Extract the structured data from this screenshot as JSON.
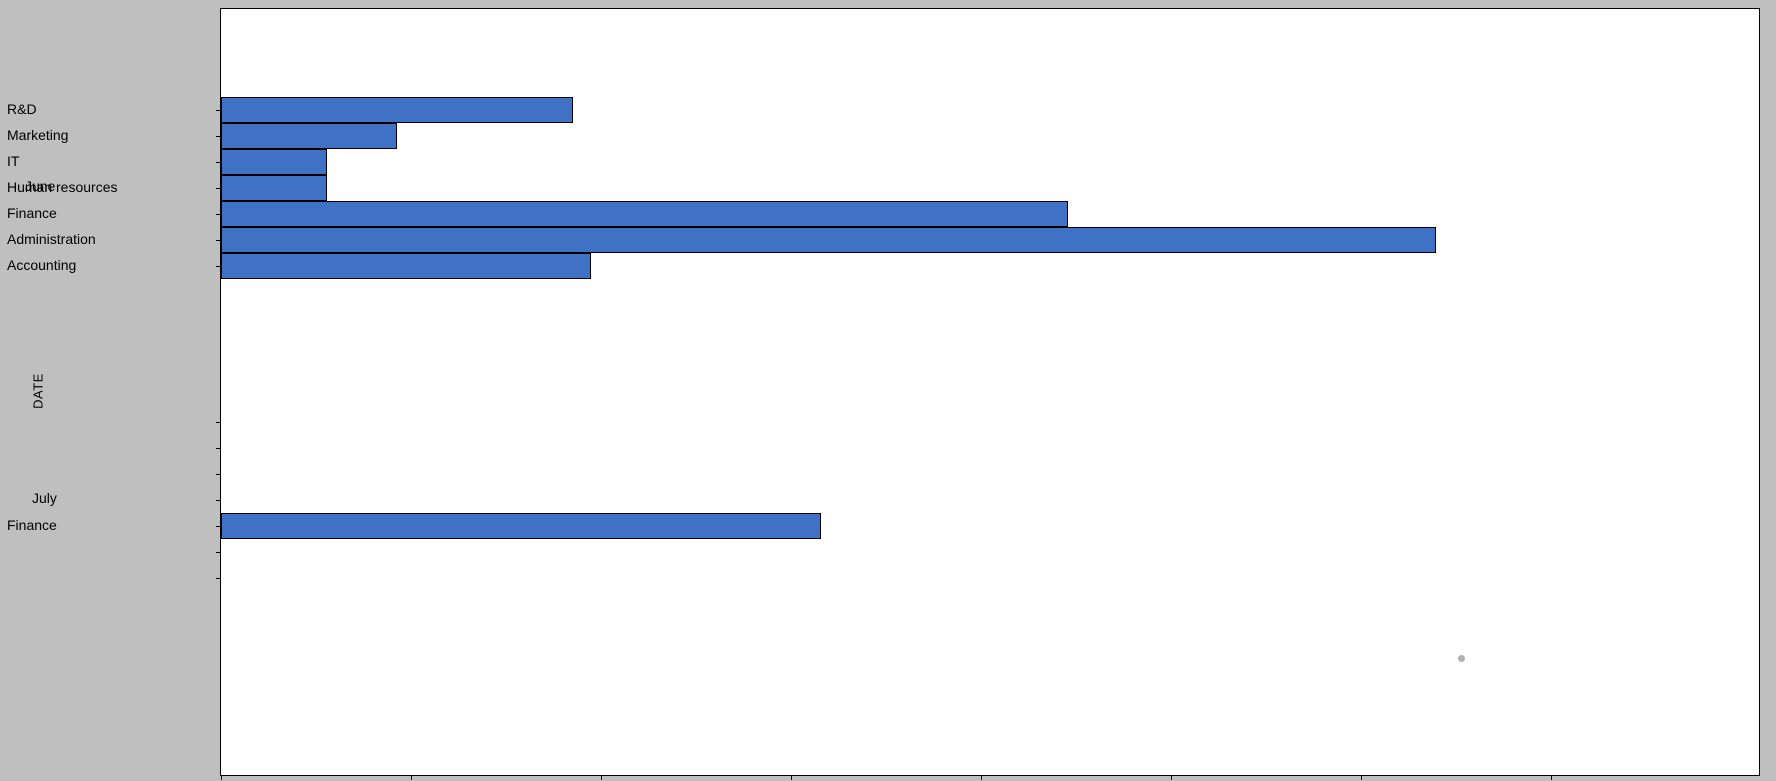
{
  "chart_data": {
    "type": "bar",
    "orientation": "horizontal",
    "ylabel": "DATE",
    "xlabel": "",
    "xlim": [
      0,
      700
    ],
    "groups": [
      {
        "name": "June",
        "categories": [
          "R&D",
          "Marketing",
          "IT",
          "Human resources",
          "Finance",
          "Administration",
          "Accounting"
        ],
        "values": [
          200,
          100,
          60,
          60,
          480,
          690,
          210
        ]
      },
      {
        "name": "July",
        "categories": [
          "Finance"
        ],
        "values": [
          340
        ]
      }
    ]
  },
  "labels": {
    "june": "June",
    "july": "July",
    "y_title": "DATE",
    "june_cats": {
      "rd": "R&D",
      "marketing": "Marketing",
      "it": "IT",
      "hr": "Human resources",
      "finance": "Finance",
      "admin": "Administration",
      "acct": "Accounting"
    },
    "july_cats": {
      "finance": "Finance"
    }
  }
}
